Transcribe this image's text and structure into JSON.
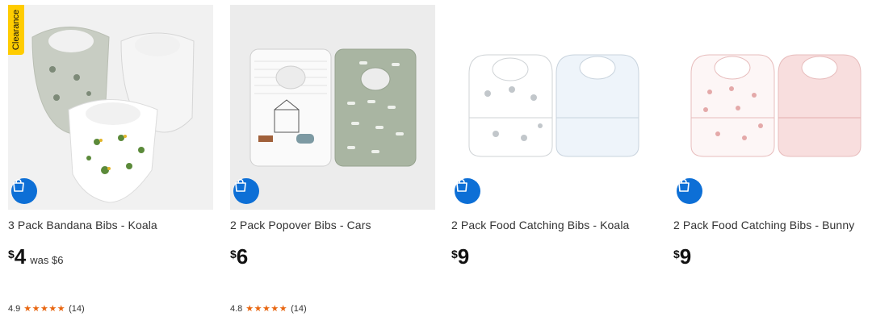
{
  "products": [
    {
      "title": "3 Pack Bandana Bibs - Koala",
      "currency": "$",
      "price": "4",
      "was": "was $6",
      "badge": "Clearance",
      "rating": "4.9",
      "stars": "★★★★★",
      "reviews": "(14)"
    },
    {
      "title": "2 Pack Popover Bibs - Cars",
      "currency": "$",
      "price": "6",
      "rating": "4.8",
      "stars": "★★★★★",
      "reviews": "(14)"
    },
    {
      "title": "2 Pack Food Catching Bibs - Koala",
      "currency": "$",
      "price": "9"
    },
    {
      "title": "2 Pack Food Catching Bibs - Bunny",
      "currency": "$",
      "price": "9"
    }
  ],
  "colors": {
    "accent": "#0d6fd6",
    "badge": "#ffcc00",
    "star": "#e8650f"
  },
  "icons": {
    "add_to_bag": "shopping-bag-icon"
  }
}
